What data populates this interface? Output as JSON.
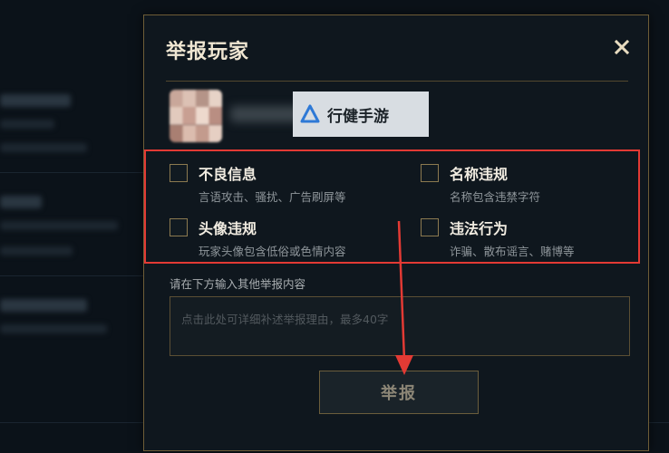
{
  "dialog": {
    "title": "举报玩家",
    "close_icon": "close-icon",
    "watermark_text": "行健手游",
    "options": [
      {
        "label": "不良信息",
        "desc": "言语攻击、骚扰、广告刷屏等"
      },
      {
        "label": "名称违规",
        "desc": "名称包含违禁字符"
      },
      {
        "label": "头像违规",
        "desc": "玩家头像包含低俗或色情内容"
      },
      {
        "label": "违法行为",
        "desc": "诈骗、散布谣言、赌博等"
      }
    ],
    "prompt": "请在下方输入其他举报内容",
    "textarea_placeholder": "点击此处可详细补述举报理由，最多40字",
    "submit_label": "举报"
  },
  "colors": {
    "accent_gold": "#6e5d37",
    "annotation_red": "#e33a34"
  }
}
